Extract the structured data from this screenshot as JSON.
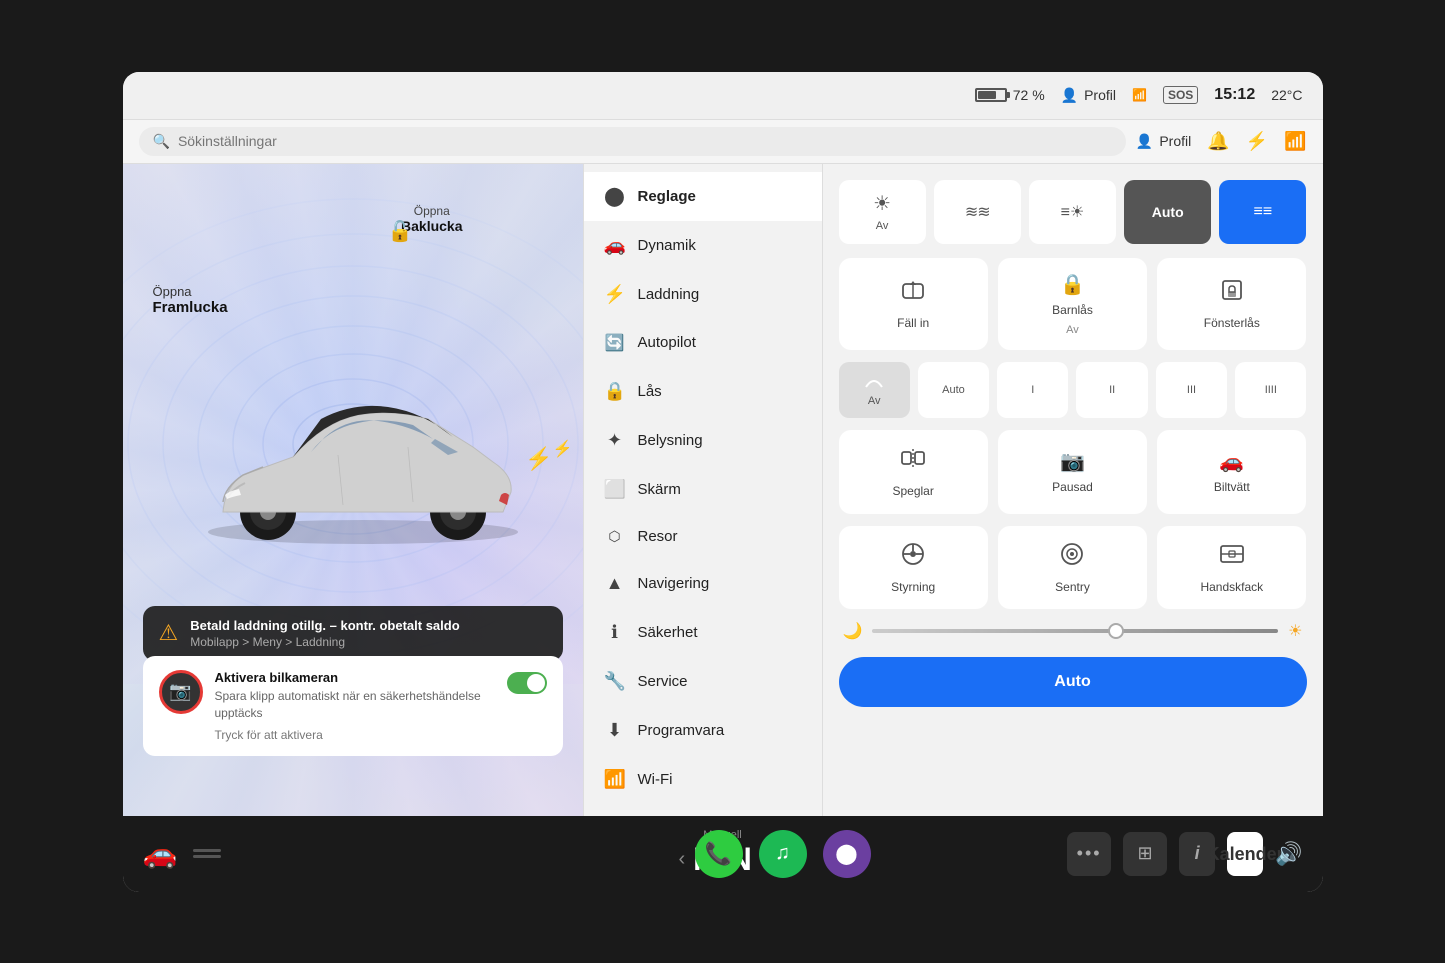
{
  "status_bar": {
    "battery_percent": "72 %",
    "profile_label": "Profil",
    "sos_label": "SOS",
    "time": "15:12",
    "temperature": "22°C"
  },
  "search": {
    "placeholder": "Sökinställningar"
  },
  "header": {
    "profile_label": "Profil",
    "notification_icon": "bell",
    "bluetooth_icon": "bluetooth",
    "wifi_icon": "wifi"
  },
  "car_labels": {
    "front_hood": "Öppna",
    "front_hood_strong": "Framlucka",
    "rear_hood": "Öppna",
    "rear_hood_strong": "Baklucka"
  },
  "warning": {
    "title": "Betald laddning otillg. – kontr. obetalt saldo",
    "subtitle": "Mobilapp > Meny > Laddning",
    "icon": "⚠"
  },
  "camera_card": {
    "title": "Aktivera bilkameran",
    "description": "Spara klipp automatiskt när en säkerhetshändelse upptäcks",
    "action": "Tryck för att aktivera"
  },
  "menu": {
    "items": [
      {
        "id": "reglage",
        "label": "Reglage",
        "icon": "⚙",
        "active": true
      },
      {
        "id": "dynamik",
        "label": "Dynamik",
        "icon": "🚗"
      },
      {
        "id": "laddning",
        "label": "Laddning",
        "icon": "⚡"
      },
      {
        "id": "autopilot",
        "label": "Autopilot",
        "icon": "🔄"
      },
      {
        "id": "las",
        "label": "Lås",
        "icon": "🔒"
      },
      {
        "id": "belysning",
        "label": "Belysning",
        "icon": "💡"
      },
      {
        "id": "skarm",
        "label": "Skärm",
        "icon": "🖥"
      },
      {
        "id": "resor",
        "label": "Resor",
        "icon": "📍"
      },
      {
        "id": "navigering",
        "label": "Navigering",
        "icon": "▲"
      },
      {
        "id": "sakerhet",
        "label": "Säkerhet",
        "icon": "ℹ"
      },
      {
        "id": "service",
        "label": "Service",
        "icon": "🔧"
      },
      {
        "id": "programvara",
        "label": "Programvara",
        "icon": "⬇"
      },
      {
        "id": "wifi",
        "label": "Wi-Fi",
        "icon": "📶"
      }
    ]
  },
  "controls": {
    "headlights": {
      "buttons": [
        {
          "label": "Av",
          "icon": "☀",
          "active": false
        },
        {
          "label": "",
          "icon": "≋",
          "active": false
        },
        {
          "label": "",
          "icon": "≡",
          "active": false
        },
        {
          "label": "Auto",
          "active": true,
          "dark": true
        },
        {
          "label": "",
          "icon": "≡",
          "active": true,
          "blue": true
        }
      ]
    },
    "row1": [
      {
        "label": "Fäll in",
        "icon": "◻",
        "sublabel": ""
      },
      {
        "label": "Barnlås",
        "icon": "🔒",
        "sublabel": "Av"
      },
      {
        "label": "Fönsterlås",
        "icon": "🖥",
        "sublabel": ""
      }
    ],
    "wipers": [
      {
        "label": "Av",
        "icon": "◡",
        "active": true
      },
      {
        "label": "Auto",
        "active": false
      },
      {
        "label": "I",
        "active": false
      },
      {
        "label": "II",
        "active": false
      },
      {
        "label": "III",
        "active": false
      },
      {
        "label": "IIII",
        "active": false
      }
    ],
    "row3": [
      {
        "label": "Speglar",
        "icon": "◻↕",
        "sublabel": ""
      },
      {
        "label": "Pausad",
        "icon": "📷",
        "sublabel": ""
      },
      {
        "label": "Biltvätt",
        "icon": "🚗",
        "sublabel": ""
      }
    ],
    "row4": [
      {
        "label": "Styrning",
        "icon": "⬤↕",
        "sublabel": ""
      },
      {
        "label": "Sentry",
        "icon": "◉",
        "sublabel": ""
      },
      {
        "label": "Handskfack",
        "icon": "🖥",
        "sublabel": ""
      }
    ],
    "auto_button": "Auto"
  },
  "taskbar": {
    "car_icon": "🚗",
    "gear_label": "Manuell",
    "gear_mode": "MIN",
    "apps": [
      {
        "label": "Telefon",
        "icon": "📞",
        "color": "#2ecc40"
      },
      {
        "label": "Spotify",
        "icon": "♫",
        "color": "#1db954"
      },
      {
        "label": "Kamera",
        "icon": "⬤",
        "color": "#6b3fa0"
      }
    ],
    "taskbar_icons": [
      {
        "label": "Mer",
        "icon": "•••"
      },
      {
        "label": "Karta",
        "icon": "⊞"
      },
      {
        "label": "Info",
        "icon": "i"
      },
      {
        "label": "Kalender",
        "icon": "23"
      }
    ],
    "volume_icon": "🔊"
  }
}
